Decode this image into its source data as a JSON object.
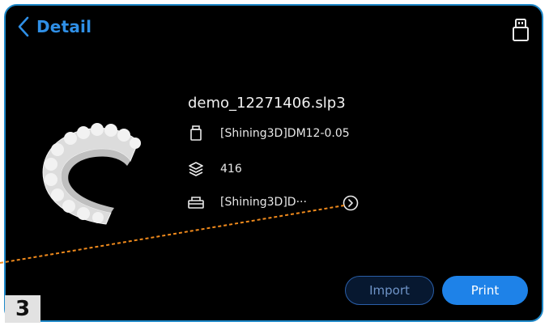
{
  "header": {
    "title": "Detail"
  },
  "file": {
    "name": "demo_12271406.slp3",
    "resin": "[Shining3D]DM12-0.05",
    "layers": "416",
    "platform": "[Shining3D]D···"
  },
  "buttons": {
    "import": "Import",
    "print": "Print"
  },
  "annotation": {
    "step": "3"
  },
  "icons": {
    "back": "chevron-left-icon",
    "usb": "usb-drive-icon",
    "resin": "resin-bottle-icon",
    "layers": "layers-icon",
    "platform": "build-platform-icon",
    "more": "chevron-right-circle-icon"
  },
  "colors": {
    "accent": "#2f8fe6",
    "frame": "#1e88c8",
    "print_button": "#1e82e8",
    "dash_line": "#f08a1c"
  }
}
